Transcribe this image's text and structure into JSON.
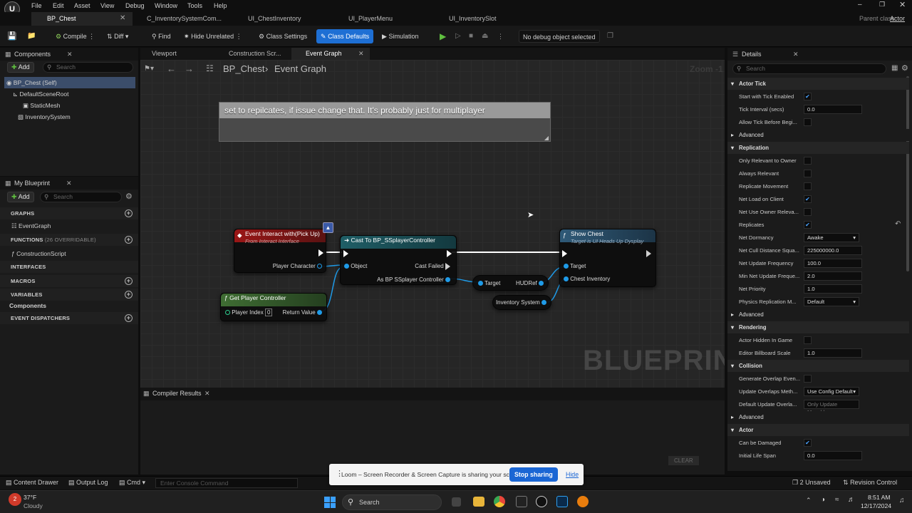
{
  "menu": [
    "File",
    "Edit",
    "Asset",
    "View",
    "Debug",
    "Window",
    "Tools",
    "Help"
  ],
  "parent_class": {
    "label": "Parent class:",
    "value": "Actor"
  },
  "doc_tabs": [
    {
      "label": "BP_Chest",
      "active": true
    },
    {
      "label": "C_InventorySystemCom..."
    },
    {
      "label": "UI_ChestInventory"
    },
    {
      "label": "UI_PlayerMenu"
    },
    {
      "label": "UI_InventorySlot"
    }
  ],
  "toolbar": {
    "compile": "Compile",
    "diff": "Diff",
    "find": "Find",
    "hide_unrelated": "Hide Unrelated",
    "class_settings": "Class Settings",
    "class_defaults": "Class Defaults",
    "simulation": "Simulation",
    "debug_object": "No debug object selected"
  },
  "components": {
    "title": "Components",
    "add": "Add",
    "search_placeholder": "Search",
    "items": [
      "BP_Chest (Self)",
      "DefaultSceneRoot",
      "StaticMesh",
      "InventorySystem"
    ]
  },
  "my_blueprint": {
    "title": "My Blueprint",
    "add": "Add",
    "search_placeholder": "Search",
    "graphs": "GRAPHS",
    "event_graph": "EventGraph",
    "functions": "FUNCTIONS",
    "functions_note": "(26 OVERRIDABLE)",
    "construction_script": "ConstructionScript",
    "interfaces": "INTERFACES",
    "macros": "MACROS",
    "variables": "VARIABLES",
    "components": "Components",
    "event_dispatchers": "EVENT DISPATCHERS"
  },
  "graph_tabs": [
    {
      "label": "Viewport"
    },
    {
      "label": "Construction Scr..."
    },
    {
      "label": "Event Graph",
      "active": true
    }
  ],
  "breadcrumb": {
    "root": "BP_Chest",
    "current": "Event Graph",
    "zoom": "Zoom -1"
  },
  "comment_text": "set to repilcates, if issue change that. It's probably just for multiplayer",
  "watermark": "BLUEPRINT",
  "nodes": {
    "event": {
      "title": "Event Interact with(Pick Up)",
      "subtitle": "From Interact Interface",
      "pin": "Player Character"
    },
    "cast": {
      "title": "Cast To BP_SSplayerController",
      "object": "Object",
      "failed": "Cast Failed",
      "as": "As BP SSplayer Controller"
    },
    "get_pc": {
      "title": "Get Player Controller",
      "index_label": "Player Index",
      "index_value": "0",
      "return": "Return Value"
    },
    "hudref": {
      "target": "Target",
      "out": "HUDRef"
    },
    "invsys": {
      "out": "Inventory System"
    },
    "show": {
      "title": "Show Chest",
      "subtitle": "Target is UI Heads Up Dysplay",
      "target": "Target",
      "chest": "Chest Inventory"
    }
  },
  "compiler": {
    "title": "Compiler Results",
    "clear": "CLEAR"
  },
  "details": {
    "title": "Details",
    "search_placeholder": "Search",
    "rows": [
      {
        "type": "cat",
        "label": "Actor Tick"
      },
      {
        "type": "check",
        "label": "Start with Tick Enabled",
        "checked": true
      },
      {
        "type": "val",
        "label": "Tick Interval (secs)",
        "value": "0.0"
      },
      {
        "type": "check",
        "label": "Allow Tick Before Begi...",
        "checked": false
      },
      {
        "type": "adv",
        "label": "Advanced"
      },
      {
        "type": "cat",
        "label": "Replication"
      },
      {
        "type": "check",
        "label": "Only Relevant to Owner",
        "checked": false
      },
      {
        "type": "check",
        "label": "Always Relevant",
        "checked": false
      },
      {
        "type": "check",
        "label": "Replicate Movement",
        "checked": false
      },
      {
        "type": "check",
        "label": "Net Load on Client",
        "checked": true
      },
      {
        "type": "check",
        "label": "Net Use Owner Releva...",
        "checked": false
      },
      {
        "type": "check",
        "label": "Replicates",
        "checked": true
      },
      {
        "type": "drop",
        "label": "Net Dormancy",
        "value": "Awake"
      },
      {
        "type": "val",
        "label": "Net Cull Distance Squa...",
        "value": "225000000.0"
      },
      {
        "type": "val",
        "label": "Net Update Frequency",
        "value": "100.0"
      },
      {
        "type": "val",
        "label": "Min Net Update Freque...",
        "value": "2.0"
      },
      {
        "type": "val",
        "label": "Net Priority",
        "value": "1.0"
      },
      {
        "type": "drop",
        "label": "Physics Replication M...",
        "value": "Default"
      },
      {
        "type": "adv",
        "label": "Advanced"
      },
      {
        "type": "cat",
        "label": "Rendering"
      },
      {
        "type": "check",
        "label": "Actor Hidden In Game",
        "checked": false
      },
      {
        "type": "val",
        "label": "Editor Billboard Scale",
        "value": "1.0"
      },
      {
        "type": "cat",
        "label": "Collision"
      },
      {
        "type": "check",
        "label": "Generate Overlap Even...",
        "checked": false
      },
      {
        "type": "drop",
        "label": "Update Overlaps Meth...",
        "value": "Use Config Default"
      },
      {
        "type": "drop",
        "label": "Default Update Overla...",
        "value": "Only Update Movable"
      },
      {
        "type": "adv",
        "label": "Advanced"
      },
      {
        "type": "cat",
        "label": "Actor"
      },
      {
        "type": "check",
        "label": "Can be Damaged",
        "checked": true
      },
      {
        "type": "val",
        "label": "Initial Life Span",
        "value": "0.0"
      }
    ]
  },
  "statusbar": {
    "content_drawer": "Content Drawer",
    "output_log": "Output Log",
    "cmd": "Cmd",
    "console_placeholder": "Enter Console Command",
    "unsaved": "2 Unsaved",
    "revision": "Revision Control"
  },
  "loom": {
    "message": "Loom – Screen Recorder & Screen Capture is sharing your screen.",
    "stop": "Stop sharing",
    "hide": "Hide"
  },
  "taskbar": {
    "temp": "37°F",
    "weather": "Cloudy",
    "search": "Search",
    "time": "8:51 AM",
    "date": "12/17/2024"
  }
}
